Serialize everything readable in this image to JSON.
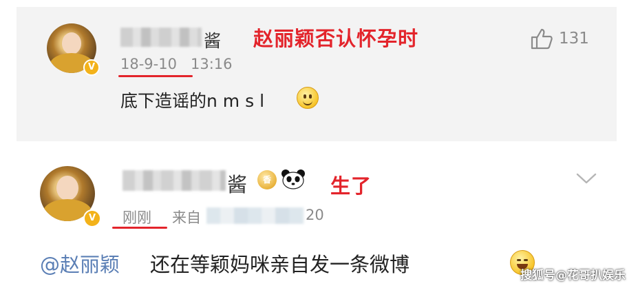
{
  "post1": {
    "username_suffix": "酱",
    "annotation": "赵丽颖否认怀孕时",
    "timestamp_date": "18-9-10",
    "timestamp_time": "13:16",
    "like_count": "131",
    "comment": "底下造谣的n m s l",
    "emoji": "smile-emoji"
  },
  "post2": {
    "username_suffix": "酱",
    "badge_text": "香",
    "annotation": "生了",
    "timestamp": "刚刚",
    "source_prefix": "来自",
    "source_suffix": "20",
    "mention": "@赵丽颖",
    "comment": "还在等颖妈咪亲自发一条微博",
    "emoji": "cry-laugh-emoji"
  },
  "watermark": "搜狐号@花哥扒娱乐",
  "colors": {
    "annotation_red": "#e3242b",
    "mention_blue": "#5b7fb5",
    "meta_gray": "#8a8a8a",
    "verify_gold": "#f3b21a"
  }
}
